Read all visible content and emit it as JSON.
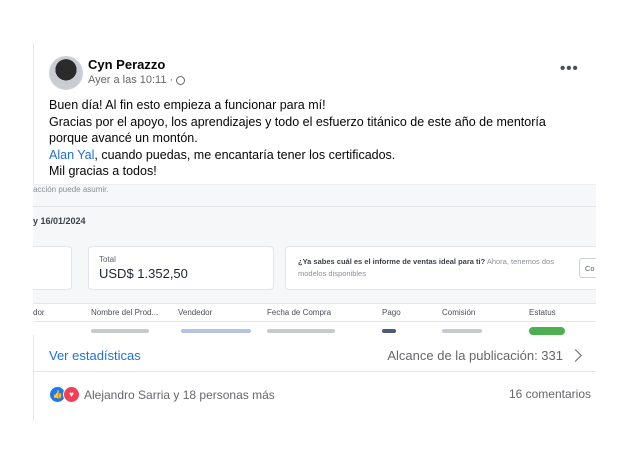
{
  "post": {
    "author": "Cyn Perazzo",
    "time": "Ayer a las 10:11",
    "separator": "·",
    "more_label": "•••",
    "lines": [
      "Buen día! Al fin esto empieza a funcionar para mí!",
      "Gracias por el apoyo, los aprendizajes y todo el esfuerzo titánico de este año de mentoría",
      "porque avancé un montón."
    ],
    "mention": "Alan Yal",
    "mention_rest": ", cuando puedas, me encantaría tener los certificados.",
    "closing": "Mil gracias a todos!"
  },
  "screenshot": {
    "top_text": "acción puede asumir.",
    "date_text": "y 16/01/2024",
    "total_label": "Total",
    "total_value": "USD$ 1.352,50",
    "info_bold": "¿Ya sabes cuál es el informe de ventas ideal para ti?",
    "info_rest": " Ahora, tenemos dos modelos disponibles",
    "button_text": "Co",
    "columns": [
      "dor",
      "Nombre del Prod...",
      "Vendedor",
      "Fecha de Compra",
      "Pago",
      "Comisión",
      "Estatus"
    ]
  },
  "footer": {
    "stats_link": "Ver estadísticas",
    "reach": "Alcance de la publicación: 331",
    "reactions_text": "Alejandro Sarria y 18 personas más",
    "comments": "16 comentarios"
  }
}
